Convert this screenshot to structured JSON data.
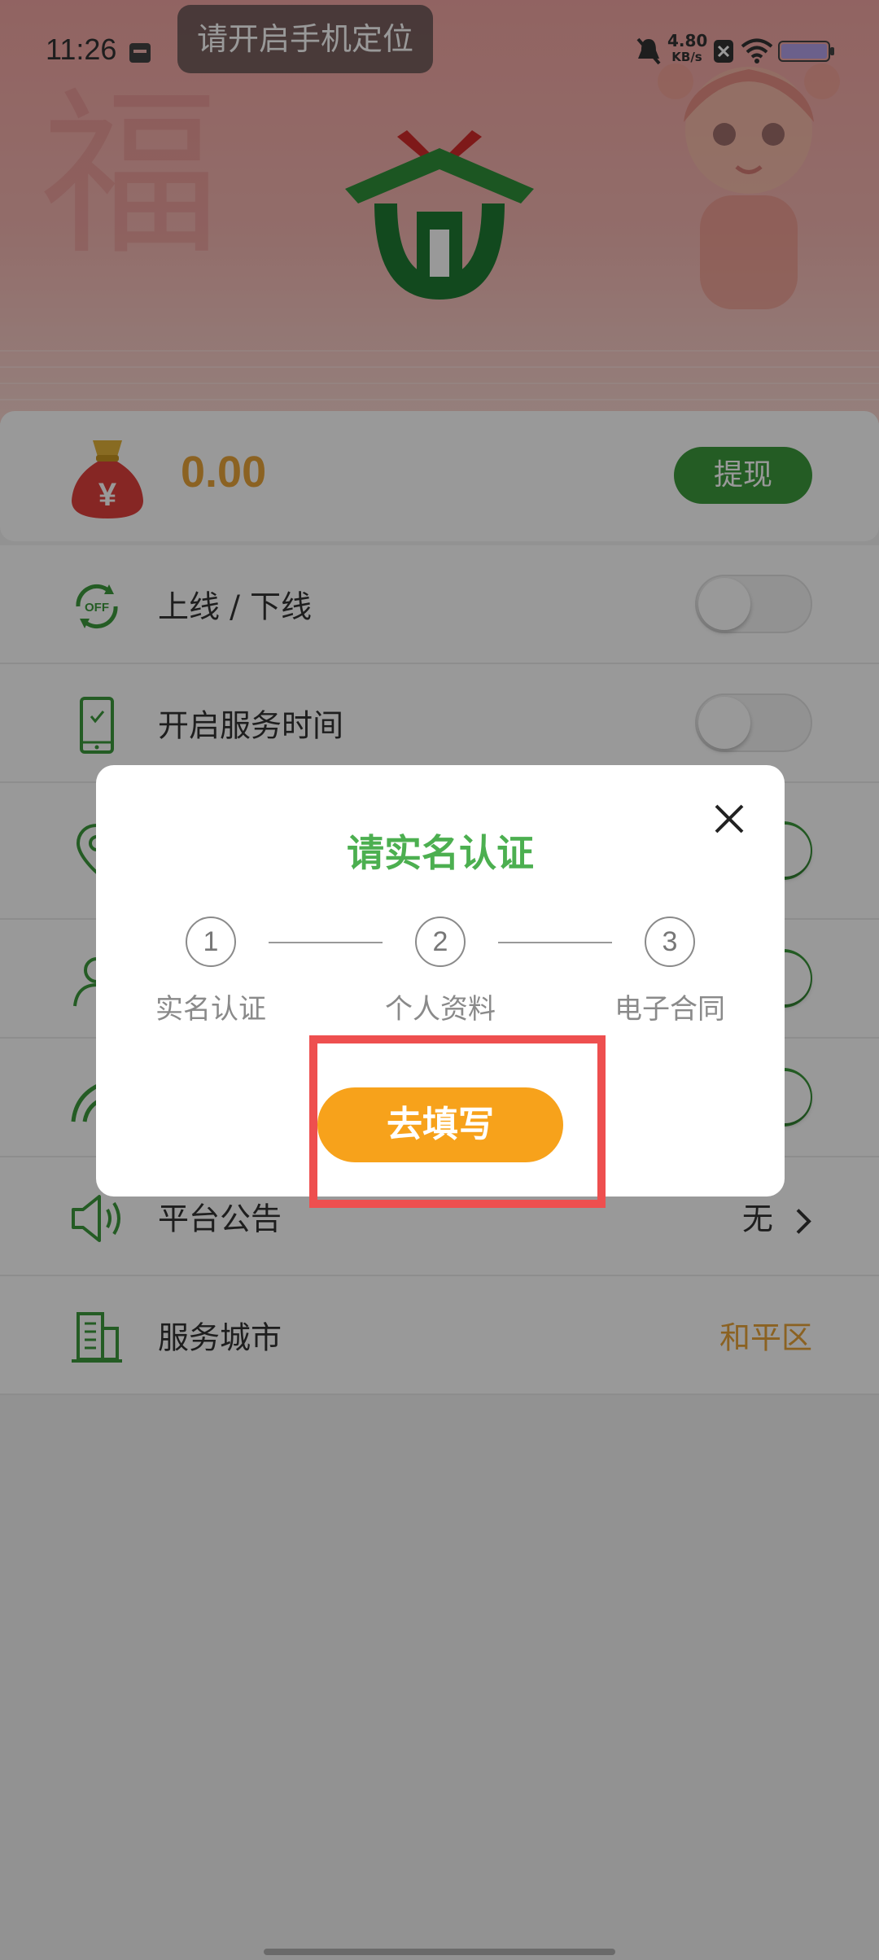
{
  "status_bar": {
    "time": "11:26",
    "network_speed_value": "4.80",
    "network_speed_unit": "KB/s",
    "toast": "请开启手机定位"
  },
  "header": {
    "decor_char": "福"
  },
  "balance_card": {
    "amount": "0.00",
    "withdraw_label": "提现",
    "bag_symbol": "¥"
  },
  "list": {
    "online_label": "上线 / 下线",
    "online_on": false,
    "service_time_label": "开启服务时间",
    "service_time_on": false,
    "announcement_label": "平台公告",
    "announcement_value": "无",
    "city_label": "服务城市",
    "city_value": "和平区",
    "off_badge": "OFF"
  },
  "dialog": {
    "title": "请实名认证",
    "steps": [
      {
        "num": "1",
        "label": "实名认证"
      },
      {
        "num": "2",
        "label": "个人资料"
      },
      {
        "num": "3",
        "label": "电子合同"
      }
    ],
    "button": "去填写"
  },
  "colors": {
    "brand_green": "#3c9a3c",
    "accent_orange": "#f7a21b",
    "amount_orange": "#e8a33a",
    "highlight_red": "#ee4f4f"
  }
}
